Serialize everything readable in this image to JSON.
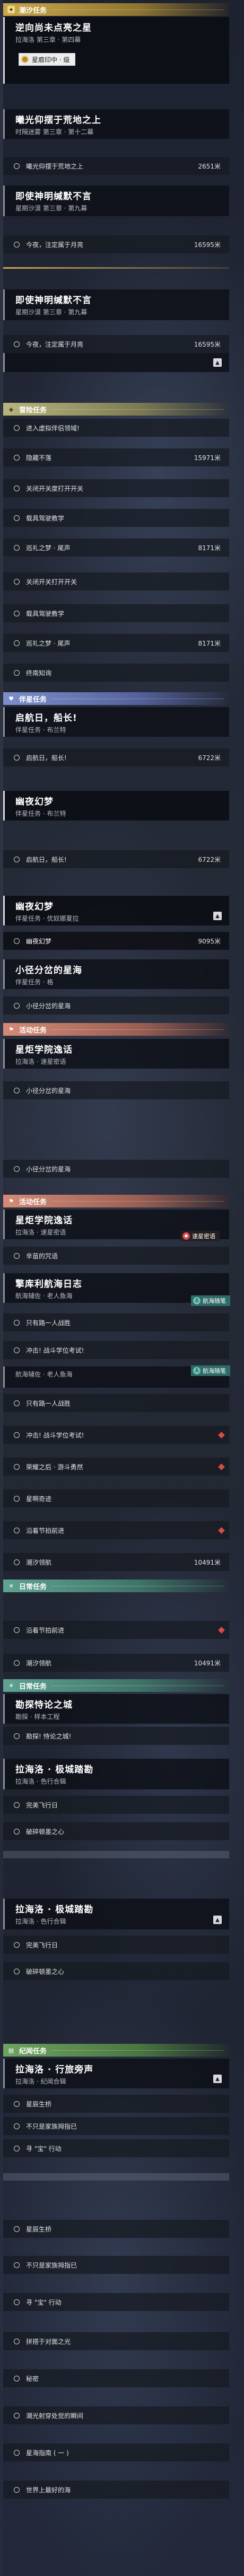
{
  "headers": {
    "tidal": "潮汐任务",
    "adventure": "冒险任务",
    "companion": "伴星任务",
    "event": "活动任务",
    "daily": "日常任务",
    "memory": "纪闻任务"
  },
  "icons": {
    "tidal": "star-icon",
    "adventure": "compass-icon",
    "companion": "heart-icon",
    "event": "flag-icon",
    "daily": "sun-icon",
    "memory": "book-icon",
    "row": "circle-icon",
    "expand": "chevron-up-icon",
    "marker": "diamond-marker-icon"
  },
  "colors": {
    "tidal": "#c9a84a",
    "adventure": "#b9b67c",
    "companion": "#7d8fcc",
    "event": "#d48a76",
    "daily": "#5fa392",
    "memory": "#6ea35f",
    "marker": "#d84a4a"
  },
  "units": {
    "meter": "米"
  },
  "quests": {
    "q1": {
      "title": "逆向尚未点亮之星",
      "sub": "拉海洛 第三章 · 第四幕",
      "pill": "星痕印中 · 级"
    },
    "q2": {
      "title": "曦光仰摆于荒地之上",
      "sub": "时隔迷雾 第三章 · 第十二幕",
      "row": "曦光仰摆于荒地之上",
      "dist": "2651米"
    },
    "q3": {
      "title": "即使神明缄默不言",
      "sub": "星期沙漠 第三章 · 第九幕",
      "row": "今夜，注定属于月亮",
      "dist": "16595米"
    },
    "q3b": {
      "title": "即使神明缄默不言",
      "sub": "星期沙漠 第三章 · 第九幕",
      "row": "今夜，注定属于月亮",
      "dist": "16595米"
    }
  },
  "adventure_a": [
    {
      "label": "进入虚拟伴侣领域!",
      "dist": ""
    },
    {
      "label": "隐藏不落",
      "dist": "15971米"
    },
    {
      "label": "关闭开关度打开开关",
      "dist": ""
    },
    {
      "label": "载具驾驶教学",
      "dist": ""
    },
    {
      "label": "巡礼之梦 · 尾声",
      "dist": "8171米"
    }
  ],
  "adventure_b": [
    {
      "label": "关闭开关打开开关",
      "dist": ""
    },
    {
      "label": "载具驾驶教学",
      "dist": ""
    },
    {
      "label": "巡礼之梦 · 尾声",
      "dist": "8171米"
    },
    {
      "label": "终南知询",
      "dist": ""
    }
  ],
  "companion": {
    "c1": {
      "title": "启航日，船长!",
      "sub": "伴星任务 · 布兰特",
      "row": "启航日，船长!",
      "dist": "6722米"
    },
    "c2": {
      "title": "幽夜幻梦",
      "sub": "伴星任务 · 布兰特"
    },
    "c2b": {
      "row": "启航日，船长!",
      "dist": "6722米"
    },
    "c3": {
      "title": "幽夜幻梦",
      "sub": "伴星任务 · 优奴娜夏拉",
      "row": "幽夜幻梦",
      "dist": "9095米"
    },
    "c4": {
      "title": "小径分岔的星海",
      "sub": "伴星任务 · 格",
      "row": "小径分岔的星海"
    }
  },
  "event": {
    "e1": {
      "title": "星炬学院逸话",
      "sub": "拉海洛 · 速星密语",
      "row": "小径分岔的星海"
    },
    "e1b": {
      "row": "小径分岔的星海"
    },
    "e2": {
      "title": "星炬学院逸话",
      "sub": "拉海洛 · 速星密语",
      "row": "辛苗的咒语",
      "tag": "速星密语"
    },
    "e3": {
      "title": "擎库利航海日志",
      "sub": "航海辅佐 · 老人鱼海",
      "tag": "航海随笔",
      "rows": [
        "只有路一人战胜",
        "冲击! 战斗学位考试!"
      ]
    },
    "e3b": {
      "title": "",
      "sub": "航海辅佐 · 老人鱼海",
      "tag": "航海随笔",
      "rows": [
        {
          "label": "只有路一人战胜",
          "dist": "",
          "mark": false
        },
        {
          "label": "冲击! 战斗学位考试!",
          "dist": "",
          "mark": true
        },
        {
          "label": "荣耀之后 · 游斗勇然",
          "dist": "",
          "mark": true
        },
        {
          "label": "星啊奇迹",
          "dist": "",
          "mark": false
        },
        {
          "label": "沿着节拍前进",
          "dist": "",
          "mark": true
        },
        {
          "label": "潮汐领航",
          "dist": "10491米",
          "mark": false
        }
      ]
    }
  },
  "daily": {
    "rows_a": [
      {
        "label": "沿着节拍前进",
        "dist": "",
        "mark": true
      },
      {
        "label": "潮汐领航",
        "dist": "10491米",
        "mark": false
      }
    ],
    "d1": {
      "title": "勘探恃论之城",
      "sub": "勘探 · 样本工程",
      "row": "勘探! 恃论之城!"
    },
    "d2": {
      "title": "拉海洛 · 极城踏勘",
      "sub": "拉海洛 · 色行合辑",
      "rows": [
        "完美飞行日",
        "破碎顿墨之心"
      ]
    },
    "d3": {
      "title": "拉海洛 · 极城踏勘",
      "sub": "拉海洛 · 色行合辑",
      "rows": [
        "完美飞行日",
        "破碎顿墨之心"
      ]
    }
  },
  "memory": {
    "m1": {
      "title": "拉海洛 · 行旅旁声",
      "sub": "拉海洛 · 纪闻合辑"
    },
    "rows_a": [
      "星辰生桥",
      "不只是家族拇指已",
      "寻 \"宝\" 行动"
    ],
    "rows_b": [
      "星辰生桥",
      "不只是家族拇指已",
      "寻 \"宝\" 行动",
      "拼搭于对面之光",
      "秘密",
      "潮光射穿处觉的瞬间",
      "星海指南 ( 一 )",
      "世界上最好的海"
    ]
  }
}
